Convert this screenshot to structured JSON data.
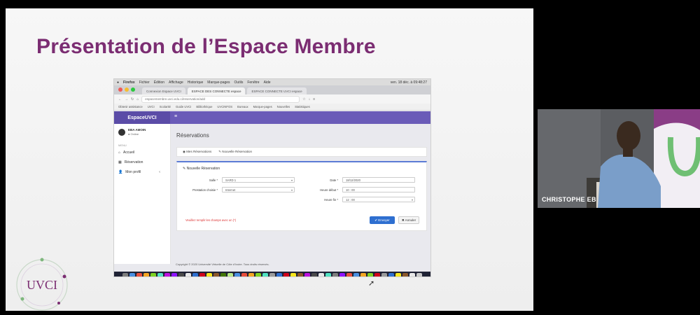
{
  "slide": {
    "title": "Présentation de l’Espace Membre"
  },
  "browser": {
    "menubar": [
      "Firefox",
      "Fichier",
      "Édition",
      "Affichage",
      "Historique",
      "Marque-pages",
      "Outils",
      "Fenêtre",
      "Aide"
    ],
    "menubar_right": "ven. 18 déc. à 09:48:27",
    "tabs": [
      "Connexion Espace UVCI",
      "ESPACE DES CONNECTE espace",
      "ESPACE CONNECTE UVCI espace"
    ],
    "url": "espacemembre.uvci.edu.ci/reservation/add",
    "bookmarks": [
      "Obtenir assistance",
      "UVCI",
      "Scolarité",
      "Guide UVCI",
      "Bibliothèque",
      "UVCINFOS",
      "Bureaux",
      "Marque-pages",
      "Nouvelles",
      "Statistiques"
    ]
  },
  "app": {
    "brand": "EspaceUVCI",
    "menu_icon": "≡",
    "user_name": "EBA AMOIN",
    "user_status": "● Online",
    "nav_section": "MENU",
    "nav": [
      {
        "label": "Accueil"
      },
      {
        "label": "Réservation"
      },
      {
        "label": "Mon profil"
      }
    ],
    "page_title": "Réservations",
    "tabs": [
      "Mes Réservations",
      "Nouvelle Réservation"
    ],
    "form_title": "Nouvelle Réservation",
    "fields": {
      "salle_label": "Salle *",
      "salle_value": "SARD 1",
      "prestation_label": "Prestation choisie *",
      "prestation_value": "Internet",
      "date_label": "Date *",
      "date_value": "18/12/2020",
      "heure_debut_label": "Heure début *",
      "heure_debut_value": "10 : 00",
      "heure_fin_label": "Heure fin *",
      "heure_fin_value": "12 : 00"
    },
    "warning": "Veuillez remplir les champs avec un (*)",
    "save_button": "✔ Envoyer",
    "cancel_button": "✖ Annuler",
    "footer": "Copyright © 2020 Université Virtuelle de Côte d'Ivoire. Tous droits réservés."
  },
  "logo": {
    "text": "UVCI"
  },
  "webcam": {
    "label": "CHRISTOPHE EB"
  }
}
